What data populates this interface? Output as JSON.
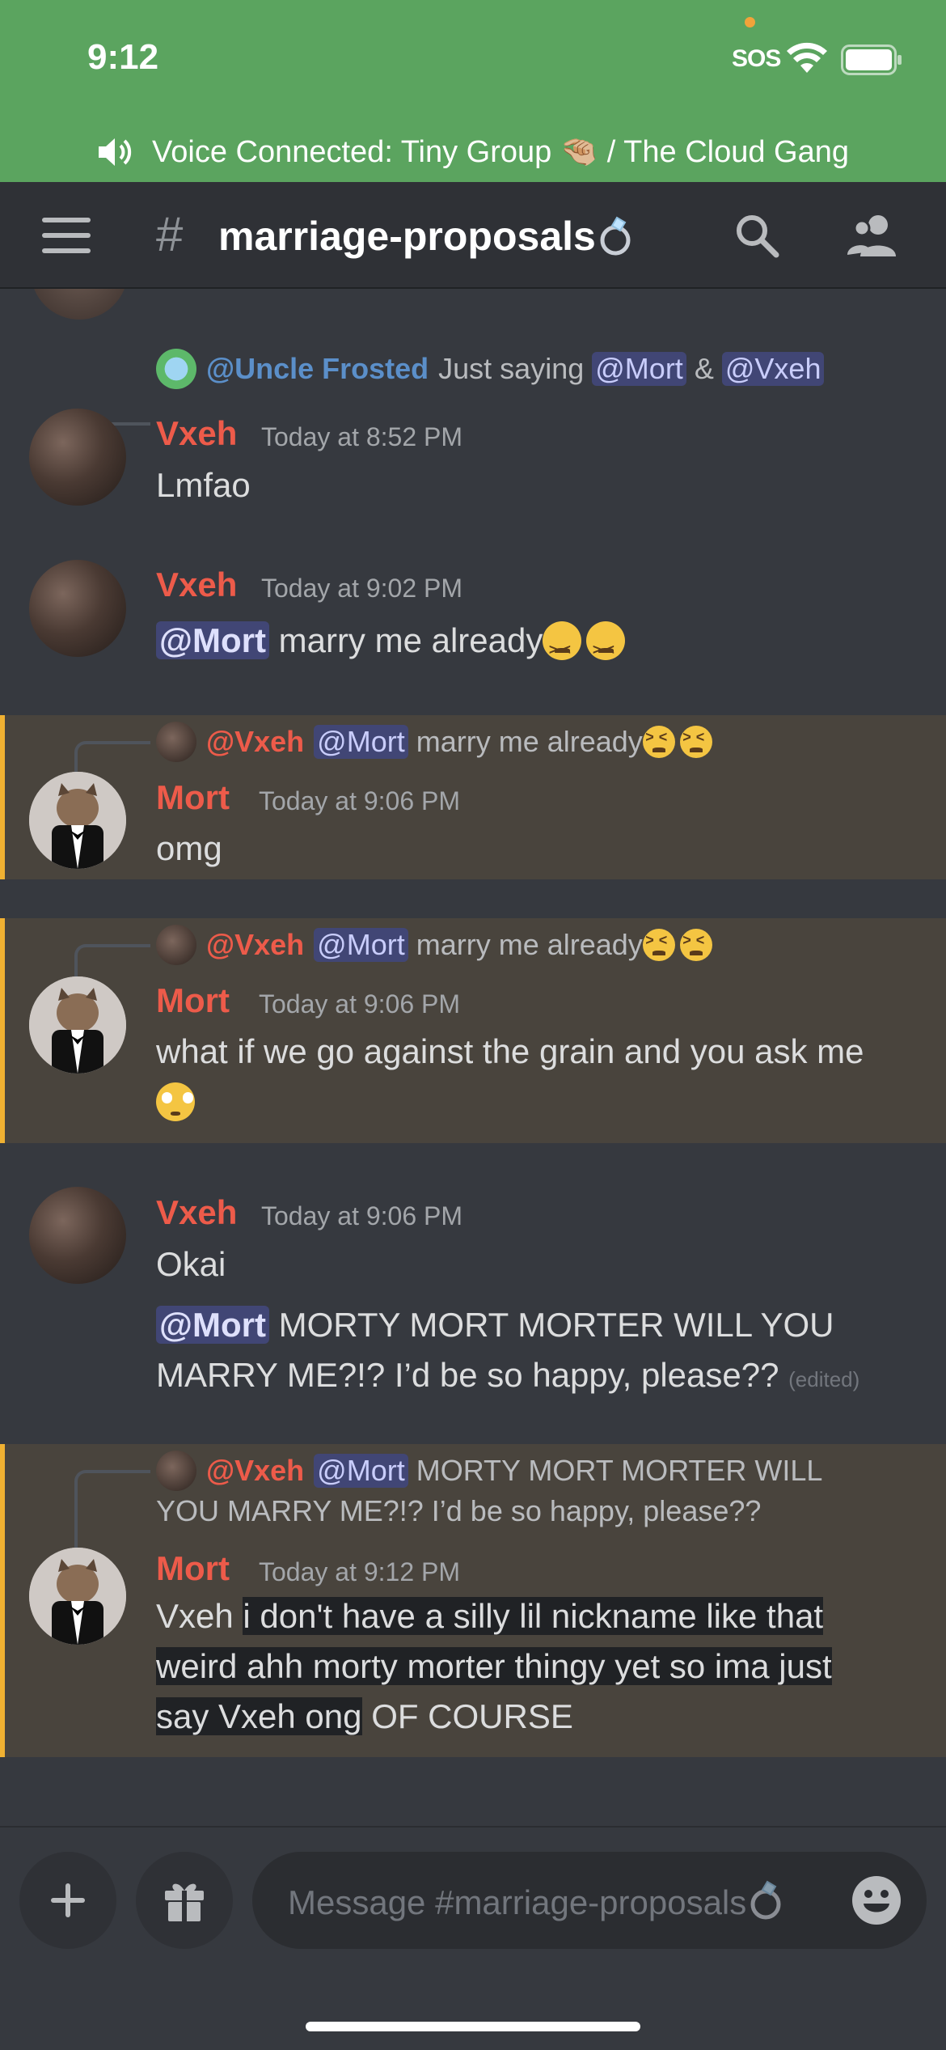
{
  "status": {
    "time": "9:12",
    "carrier": "SOS"
  },
  "voice": {
    "text": "Voice Connected: Tiny Group 🤏🏼 / The Cloud Gang"
  },
  "header": {
    "hash": "#",
    "channel": "marriage-proposals"
  },
  "messages": [
    {
      "reply_to": {
        "name": "@Uncle Frosted",
        "text_a": "Just saying",
        "mention_a": "@Mort",
        "amp": "&",
        "mention_b": "@Vxeh"
      },
      "author": "Vxeh",
      "time": "Today at 8:52 PM",
      "text": "Lmfao"
    },
    {
      "author": "Vxeh",
      "time": "Today at 9:02 PM",
      "mention": "@Mort",
      "text": "marry me already"
    },
    {
      "reply_to": {
        "name": "@Vxeh",
        "mention": "@Mort",
        "text": "marry me already"
      },
      "author": "Mort",
      "time": "Today at 9:06 PM",
      "text": "omg"
    },
    {
      "reply_to": {
        "name": "@Vxeh",
        "mention": "@Mort",
        "text": "marry me already"
      },
      "author": "Mort",
      "time": "Today at 9:06 PM",
      "text": "what if we go against the grain and you ask me"
    },
    {
      "author": "Vxeh",
      "time": "Today at 9:06 PM",
      "text": "Okai",
      "followup_mention": "@Mort",
      "followup_text": "MORTY MORT MORTER WILL YOU MARRY ME?!? I’d be so happy, please??",
      "edited": "(edited)"
    },
    {
      "reply_to": {
        "name": "@Vxeh",
        "mention": "@Mort",
        "text_line1": "MORTY MORT MORTER WILL",
        "text_line2": "YOU MARRY ME?!? I’d be so happy, please??"
      },
      "author": "Mort",
      "time": "Today at 9:12 PM",
      "text_line1_a": "Vxeh",
      "text_line1_b": "i don't have a silly lil nickname like that",
      "text_line2": "weird ahh morty morter thingy yet so ima just",
      "text_line3_a": "say Vxeh ong",
      "text_line3_b": "OF COURSE"
    }
  ],
  "composer": {
    "placeholder": "Message #marriage-proposals"
  },
  "colors": {
    "status_green": "#5ba45f",
    "author_red": "#ed5b4a",
    "highlight_bar": "#f0b132",
    "mention_bg": "#414675"
  },
  "icons": [
    "speaker-icon",
    "hamburger-icon",
    "search-icon",
    "members-icon",
    "plus-icon",
    "gift-icon",
    "emoji-icon",
    "ring-emoji"
  ]
}
